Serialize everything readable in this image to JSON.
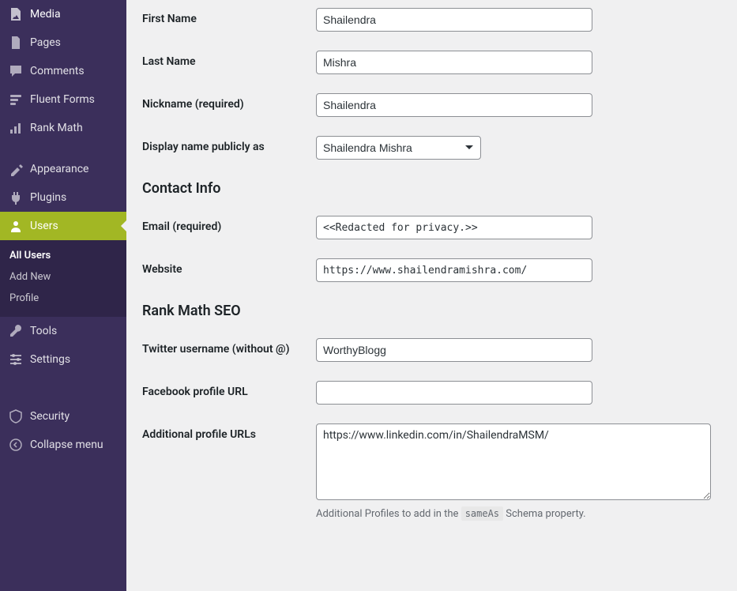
{
  "sidebar": {
    "items": [
      {
        "label": "Media"
      },
      {
        "label": "Pages"
      },
      {
        "label": "Comments"
      },
      {
        "label": "Fluent Forms"
      },
      {
        "label": "Rank Math"
      },
      {
        "label": "Appearance"
      },
      {
        "label": "Plugins"
      },
      {
        "label": "Users"
      },
      {
        "label": "Tools"
      },
      {
        "label": "Settings"
      },
      {
        "label": "Security"
      },
      {
        "label": "Collapse menu"
      }
    ],
    "submenu": [
      {
        "label": "All Users"
      },
      {
        "label": "Add New"
      },
      {
        "label": "Profile"
      }
    ]
  },
  "form": {
    "first_name": {
      "label": "First Name",
      "value": "Shailendra"
    },
    "last_name": {
      "label": "Last Name",
      "value": "Mishra"
    },
    "nickname": {
      "label": "Nickname (required)",
      "value": "Shailendra"
    },
    "display_name": {
      "label": "Display name publicly as",
      "value": "Shailendra Mishra"
    },
    "contact_heading": "Contact Info",
    "email": {
      "label": "Email (required)",
      "value": "<<Redacted for privacy.>>"
    },
    "website": {
      "label": "Website",
      "value": "https://www.shailendramishra.com/"
    },
    "rankmath_heading": "Rank Math SEO",
    "twitter": {
      "label": "Twitter username (without @)",
      "value": "WorthyBlogg"
    },
    "facebook": {
      "label": "Facebook profile URL",
      "value": ""
    },
    "additional": {
      "label": "Additional profile URLs",
      "value": "https://www.linkedin.com/in/ShailendraMSM/"
    },
    "additional_desc_pre": "Additional Profiles to add in the ",
    "additional_desc_code": "sameAs",
    "additional_desc_post": " Schema property."
  }
}
